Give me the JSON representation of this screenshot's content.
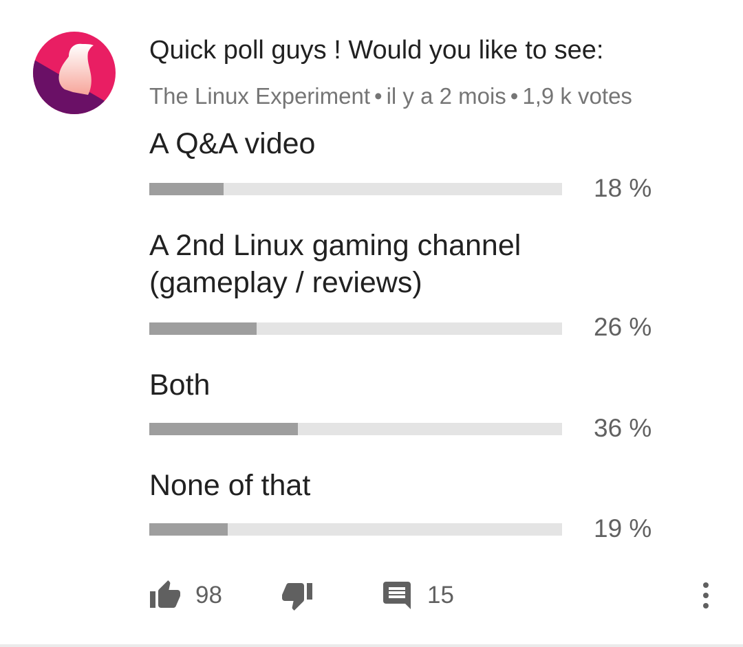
{
  "post": {
    "title": "Quick poll guys ! Would you like to see:",
    "channel": "The Linux Experiment",
    "time": "il y a 2 mois",
    "votes": "1,9 k votes",
    "separator": "•"
  },
  "poll": {
    "options": [
      {
        "label": "A Q&A video",
        "percent_text": "18 %",
        "percent": 18
      },
      {
        "label": "A 2nd Linux gaming channel (gameplay / reviews)",
        "percent_text": "26 %",
        "percent": 26
      },
      {
        "label": "Both",
        "percent_text": "36 %",
        "percent": 36
      },
      {
        "label": "None of that",
        "percent_text": "19 %",
        "percent": 19
      }
    ]
  },
  "actions": {
    "likes": "98",
    "comments": "15"
  },
  "colors": {
    "avatar_pink": "#e91e63",
    "avatar_purple": "#6a1066",
    "bar_fill": "#9e9e9e",
    "bar_track": "#e4e4e4"
  },
  "icons": {
    "avatar": "linux-experiment-penguin-logo",
    "like": "thumb-up-icon",
    "dislike": "thumb-down-icon",
    "comment": "comment-icon",
    "more": "more-vertical-icon"
  }
}
